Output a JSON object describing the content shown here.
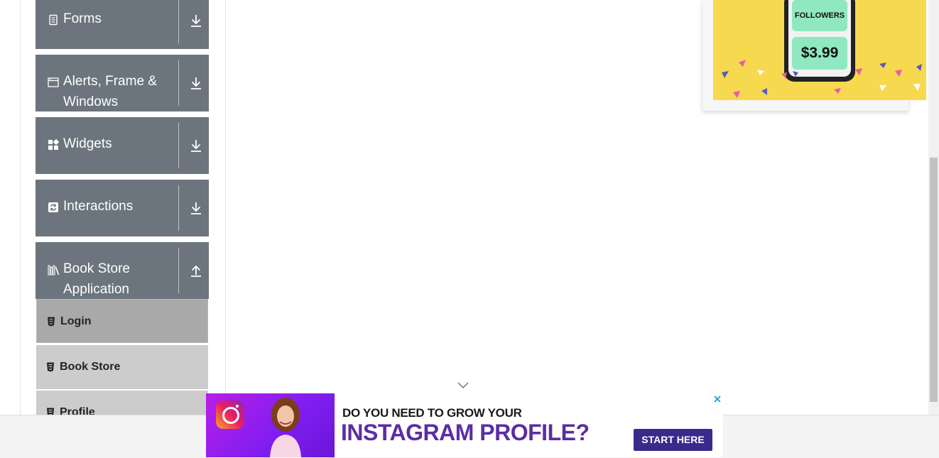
{
  "sidebar": {
    "groups": [
      {
        "label": "Forms",
        "icon": "document-icon",
        "toggle": "download-arrow-icon"
      },
      {
        "label": "Alerts, Frame & Windows",
        "icon": "window-icon",
        "toggle": "download-arrow-icon"
      },
      {
        "label": "Widgets",
        "icon": "widgets-grid-icon",
        "toggle": "download-arrow-icon"
      },
      {
        "label": "Interactions",
        "icon": "refresh-icon",
        "toggle": "download-arrow-icon"
      },
      {
        "label": "Book Store Application",
        "icon": "books-icon",
        "toggle": "upload-arrow-icon"
      }
    ],
    "menu_items": [
      {
        "label": "Login",
        "state": "active"
      },
      {
        "label": "Book Store",
        "state": "normal"
      },
      {
        "label": "Profile",
        "state": "normal"
      }
    ]
  },
  "ad_card": {
    "followers_label": "FOLLOWERS",
    "price": "$3.99"
  },
  "banner": {
    "line1": "DO YOU NEED TO GROW YOUR",
    "line2": "INSTAGRAM PROFILE?",
    "cta": "START HERE"
  },
  "colors": {
    "group_bg": "#6c757d",
    "menu_active_bg": "#a9a9a9",
    "menu_bg": "#cccccc",
    "banner_purple": "#5b2da4",
    "cta_bg": "#3b2a8c",
    "ad_yellow": "#f6d94f",
    "tile_green": "#8fe8c0"
  }
}
